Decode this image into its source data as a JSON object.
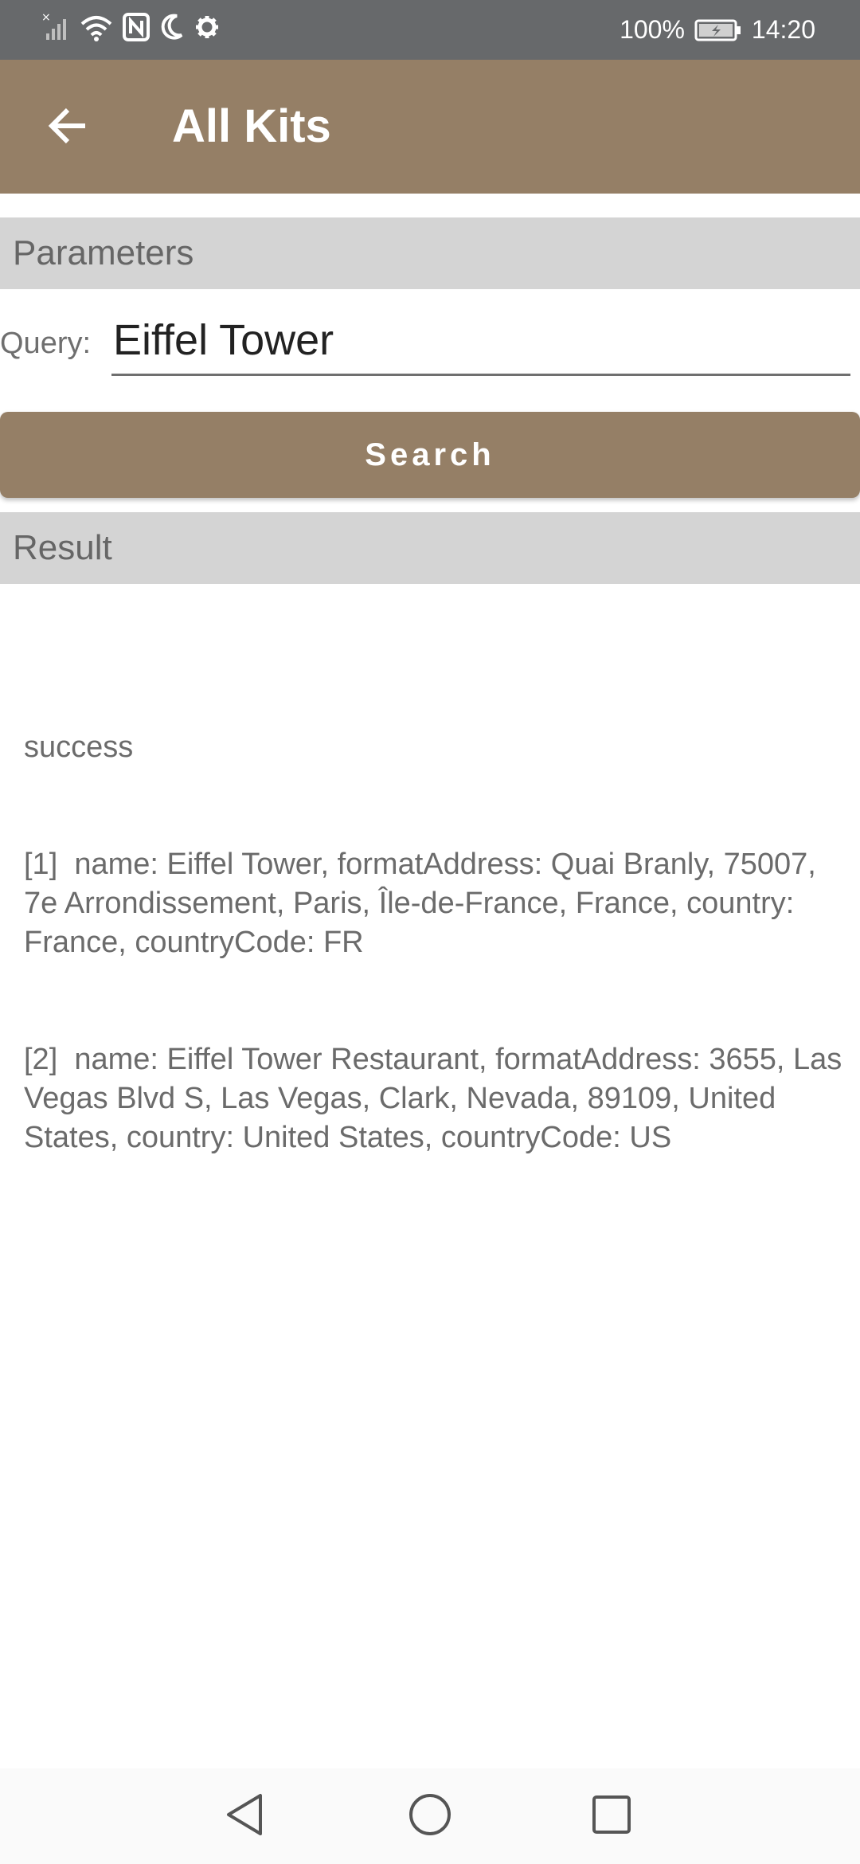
{
  "status_bar": {
    "battery_percent": "100%",
    "time": "14:20",
    "icons": [
      "signal-icon",
      "wifi-icon",
      "nfc-icon",
      "moon-icon",
      "gear-icon",
      "battery-charging-icon"
    ]
  },
  "app_bar": {
    "title": "All Kits",
    "back_icon": "arrow-left-icon"
  },
  "parameters": {
    "header": "Parameters",
    "query_label": "Query:",
    "query_value": "Eiffel Tower",
    "search_button": "Search"
  },
  "result": {
    "header": "Result",
    "status": "success",
    "items": [
      "[1]  name: Eiffel Tower, formatAddress: Quai Branly, 75007, 7e Arrondissement, Paris, Île-de-France, France, country: France, countryCode: FR",
      "[2]  name: Eiffel Tower Restaurant, formatAddress: 3655, Las Vegas Blvd S, Las Vegas, Clark, Nevada, 89109, United States, country: United States, countryCode: US"
    ]
  },
  "nav_bar": {
    "icons": [
      "nav-back-icon",
      "nav-home-icon",
      "nav-recent-icon"
    ]
  },
  "colors": {
    "status_bar": "#67696b",
    "accent": "#957f66",
    "section_header": "#d4d4d4",
    "text_gray": "#6b6b6b"
  }
}
